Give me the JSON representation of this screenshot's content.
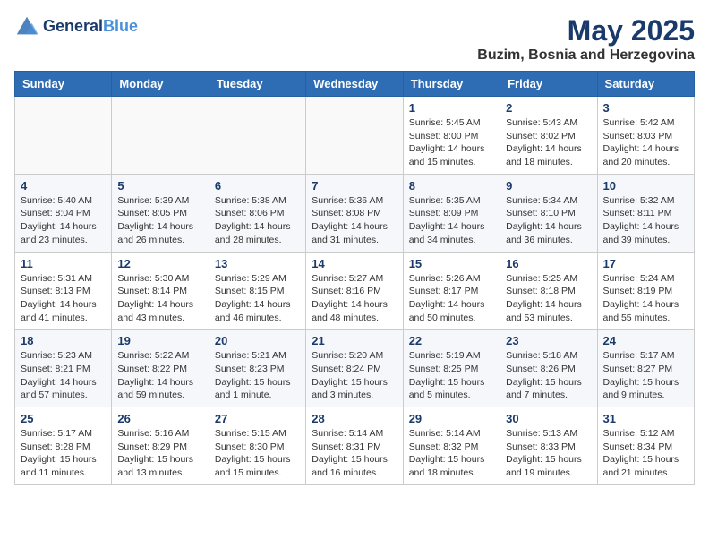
{
  "header": {
    "logo_line1": "General",
    "logo_line2": "Blue",
    "month_year": "May 2025",
    "location": "Buzim, Bosnia and Herzegovina"
  },
  "days_of_week": [
    "Sunday",
    "Monday",
    "Tuesday",
    "Wednesday",
    "Thursday",
    "Friday",
    "Saturday"
  ],
  "weeks": [
    [
      {
        "day": "",
        "info": ""
      },
      {
        "day": "",
        "info": ""
      },
      {
        "day": "",
        "info": ""
      },
      {
        "day": "",
        "info": ""
      },
      {
        "day": "1",
        "info": "Sunrise: 5:45 AM\nSunset: 8:00 PM\nDaylight: 14 hours\nand 15 minutes."
      },
      {
        "day": "2",
        "info": "Sunrise: 5:43 AM\nSunset: 8:02 PM\nDaylight: 14 hours\nand 18 minutes."
      },
      {
        "day": "3",
        "info": "Sunrise: 5:42 AM\nSunset: 8:03 PM\nDaylight: 14 hours\nand 20 minutes."
      }
    ],
    [
      {
        "day": "4",
        "info": "Sunrise: 5:40 AM\nSunset: 8:04 PM\nDaylight: 14 hours\nand 23 minutes."
      },
      {
        "day": "5",
        "info": "Sunrise: 5:39 AM\nSunset: 8:05 PM\nDaylight: 14 hours\nand 26 minutes."
      },
      {
        "day": "6",
        "info": "Sunrise: 5:38 AM\nSunset: 8:06 PM\nDaylight: 14 hours\nand 28 minutes."
      },
      {
        "day": "7",
        "info": "Sunrise: 5:36 AM\nSunset: 8:08 PM\nDaylight: 14 hours\nand 31 minutes."
      },
      {
        "day": "8",
        "info": "Sunrise: 5:35 AM\nSunset: 8:09 PM\nDaylight: 14 hours\nand 34 minutes."
      },
      {
        "day": "9",
        "info": "Sunrise: 5:34 AM\nSunset: 8:10 PM\nDaylight: 14 hours\nand 36 minutes."
      },
      {
        "day": "10",
        "info": "Sunrise: 5:32 AM\nSunset: 8:11 PM\nDaylight: 14 hours\nand 39 minutes."
      }
    ],
    [
      {
        "day": "11",
        "info": "Sunrise: 5:31 AM\nSunset: 8:13 PM\nDaylight: 14 hours\nand 41 minutes."
      },
      {
        "day": "12",
        "info": "Sunrise: 5:30 AM\nSunset: 8:14 PM\nDaylight: 14 hours\nand 43 minutes."
      },
      {
        "day": "13",
        "info": "Sunrise: 5:29 AM\nSunset: 8:15 PM\nDaylight: 14 hours\nand 46 minutes."
      },
      {
        "day": "14",
        "info": "Sunrise: 5:27 AM\nSunset: 8:16 PM\nDaylight: 14 hours\nand 48 minutes."
      },
      {
        "day": "15",
        "info": "Sunrise: 5:26 AM\nSunset: 8:17 PM\nDaylight: 14 hours\nand 50 minutes."
      },
      {
        "day": "16",
        "info": "Sunrise: 5:25 AM\nSunset: 8:18 PM\nDaylight: 14 hours\nand 53 minutes."
      },
      {
        "day": "17",
        "info": "Sunrise: 5:24 AM\nSunset: 8:19 PM\nDaylight: 14 hours\nand 55 minutes."
      }
    ],
    [
      {
        "day": "18",
        "info": "Sunrise: 5:23 AM\nSunset: 8:21 PM\nDaylight: 14 hours\nand 57 minutes."
      },
      {
        "day": "19",
        "info": "Sunrise: 5:22 AM\nSunset: 8:22 PM\nDaylight: 14 hours\nand 59 minutes."
      },
      {
        "day": "20",
        "info": "Sunrise: 5:21 AM\nSunset: 8:23 PM\nDaylight: 15 hours\nand 1 minute."
      },
      {
        "day": "21",
        "info": "Sunrise: 5:20 AM\nSunset: 8:24 PM\nDaylight: 15 hours\nand 3 minutes."
      },
      {
        "day": "22",
        "info": "Sunrise: 5:19 AM\nSunset: 8:25 PM\nDaylight: 15 hours\nand 5 minutes."
      },
      {
        "day": "23",
        "info": "Sunrise: 5:18 AM\nSunset: 8:26 PM\nDaylight: 15 hours\nand 7 minutes."
      },
      {
        "day": "24",
        "info": "Sunrise: 5:17 AM\nSunset: 8:27 PM\nDaylight: 15 hours\nand 9 minutes."
      }
    ],
    [
      {
        "day": "25",
        "info": "Sunrise: 5:17 AM\nSunset: 8:28 PM\nDaylight: 15 hours\nand 11 minutes."
      },
      {
        "day": "26",
        "info": "Sunrise: 5:16 AM\nSunset: 8:29 PM\nDaylight: 15 hours\nand 13 minutes."
      },
      {
        "day": "27",
        "info": "Sunrise: 5:15 AM\nSunset: 8:30 PM\nDaylight: 15 hours\nand 15 minutes."
      },
      {
        "day": "28",
        "info": "Sunrise: 5:14 AM\nSunset: 8:31 PM\nDaylight: 15 hours\nand 16 minutes."
      },
      {
        "day": "29",
        "info": "Sunrise: 5:14 AM\nSunset: 8:32 PM\nDaylight: 15 hours\nand 18 minutes."
      },
      {
        "day": "30",
        "info": "Sunrise: 5:13 AM\nSunset: 8:33 PM\nDaylight: 15 hours\nand 19 minutes."
      },
      {
        "day": "31",
        "info": "Sunrise: 5:12 AM\nSunset: 8:34 PM\nDaylight: 15 hours\nand 21 minutes."
      }
    ]
  ]
}
